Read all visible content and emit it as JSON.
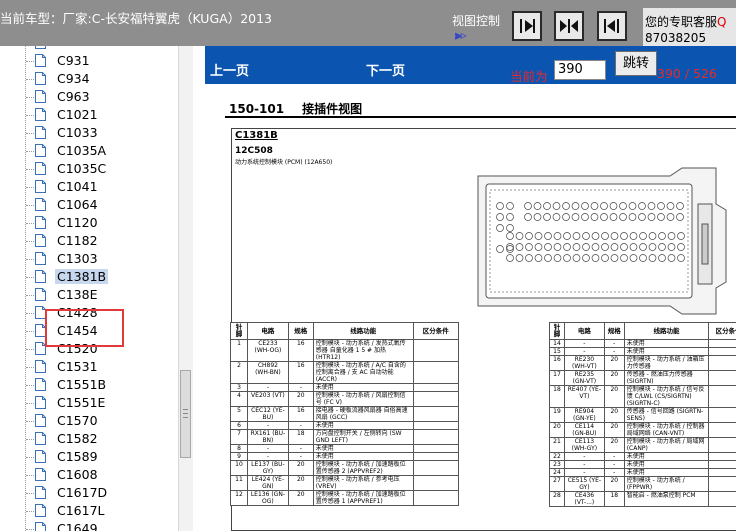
{
  "header": {
    "title": "当前车型：厂家:C-长安福特翼虎（KUGA）2013",
    "view_control_label": "视图控制",
    "arrow_symbol": "⫸▹",
    "service_label_prefix": "您的专职客服",
    "service_label_suffix": "Q",
    "service_phone": "87038205"
  },
  "sidebar": {
    "items": [
      {
        "label": "C931"
      },
      {
        "label": "C934"
      },
      {
        "label": "C963"
      },
      {
        "label": "C1021"
      },
      {
        "label": "C1033"
      },
      {
        "label": "C1035A"
      },
      {
        "label": "C1035C"
      },
      {
        "label": "C1041"
      },
      {
        "label": "C1064"
      },
      {
        "label": "C1120"
      },
      {
        "label": "C1182"
      },
      {
        "label": "C1303"
      },
      {
        "label": "C1381B",
        "selected": true
      },
      {
        "label": "C138E"
      },
      {
        "label": "C1428"
      },
      {
        "label": "C1454"
      },
      {
        "label": "C1520"
      },
      {
        "label": "C1531"
      },
      {
        "label": "C1551B"
      },
      {
        "label": "C1551E"
      },
      {
        "label": "C1570"
      },
      {
        "label": "C1582"
      },
      {
        "label": "C1589"
      },
      {
        "label": "C1608"
      },
      {
        "label": "C1617D"
      },
      {
        "label": "C1617L"
      },
      {
        "label": "C1649"
      }
    ]
  },
  "toolbar": {
    "prev_label": "上一页",
    "next_label": "下一页",
    "current_label": "当前为",
    "current_page": "390",
    "jump_label": "跳转",
    "page_count": "390 / 526"
  },
  "document": {
    "section_number": "150-101",
    "section_title": "接插件视图",
    "connector_name": "C1381B",
    "connector_code": "12C508",
    "connector_desc": "动力系统控制模块 (PCM) (12A650)",
    "table_headers": [
      "针脚",
      "电路",
      "规格",
      "线路功能",
      "区分条件"
    ],
    "left_rows": [
      [
        "1",
        "CE233 (WH-OG)",
        "16",
        "控制模块 - 动力系统 / 发热式氧传感器 自童化器 1 5 # 加热 (HTR12)",
        ""
      ],
      [
        "2",
        "CH892 (WH-BN)",
        "16",
        "控制模块 - 动力系统 / A/C 自含的控制离合器 / 支 AC 自动功能 (ACCR)",
        ""
      ],
      [
        "3",
        "-",
        "-",
        "未使用",
        ""
      ],
      [
        "4",
        "VE203 (VT)",
        "20",
        "控制模块 - 动力系统 / 风扇控制信号 (FC V)",
        ""
      ],
      [
        "5",
        "CEC12 (YE-BU)",
        "16",
        "接电器 - 硬板流器风扇器 自俗高速风扇 (GCC)",
        ""
      ],
      [
        "6",
        "-",
        "-",
        "未使用",
        ""
      ],
      [
        "7",
        "RX161 (BU-BN)",
        "18",
        "方向盘控制开关 / 左侧转向 (SW GND LEFT)",
        ""
      ],
      [
        "8",
        "-",
        "-",
        "未使用",
        ""
      ],
      [
        "9",
        "-",
        "-",
        "未使用",
        ""
      ],
      [
        "10",
        "LE137 (BU-GY)",
        "20",
        "控制模块 - 动力系统 / 加速踏板位置传感器 2 (APPVREF2)",
        ""
      ],
      [
        "11",
        "LE424 (YE-GN)",
        "20",
        "控制模块 - 动力系统 / 参考电压 (VREV)",
        ""
      ],
      [
        "12",
        "LE136 (GN-OG)",
        "20",
        "控制模块 - 动力系统 / 加速踏板位置传感器 1 (APPVREF1)",
        ""
      ]
    ],
    "right_rows": [
      [
        "14",
        "-",
        "-",
        "未使用",
        ""
      ],
      [
        "15",
        "-",
        "-",
        "未使用",
        ""
      ],
      [
        "16",
        "RE230 (WH-VT)",
        "20",
        "控制模块 - 动力系统 / 油箱压力传感器",
        ""
      ],
      [
        "17",
        "RE235 (GN-VT)",
        "20",
        "传感器 - 燃油压力传感器 (SIGRTN)",
        ""
      ],
      [
        "18",
        "RE407 (YE-VT)",
        "20",
        "控制模块 - 动力系统 / 信号反馈 C/LWL (CS/SIGRTN) (SIGRTN-C)",
        ""
      ],
      [
        "19",
        "RE904 (GN-YE)",
        "20",
        "传感器 - 信号回路 (SIGRTN-SENS)",
        ""
      ],
      [
        "20",
        "CE114 (GN-BU)",
        "20",
        "控制模块 - 动力系统 / 控制器局域网络 (CAN-VNT)",
        ""
      ],
      [
        "21",
        "CE113 (WH-GY)",
        "20",
        "控制模块 - 动力系统 / 局域网 (CANP)",
        ""
      ],
      [
        "22",
        "-",
        "-",
        "未使用",
        ""
      ],
      [
        "23",
        "-",
        "-",
        "未使用",
        ""
      ],
      [
        "24",
        "-",
        "-",
        "未使用",
        ""
      ],
      [
        "27",
        "CE515 (YE-GY)",
        "20",
        "控制模块 - 动力系统 / (FPPWR)",
        ""
      ],
      [
        "28",
        "CE436 (VT-...)",
        "18",
        "智能启 - 燃油泵控制 PCM",
        ""
      ]
    ]
  },
  "colors": {
    "topbar": "#8e8e8e",
    "toolbar": "#0b55b1",
    "highlight_box": "#e23a3a",
    "page_text": "#e52a2a"
  }
}
